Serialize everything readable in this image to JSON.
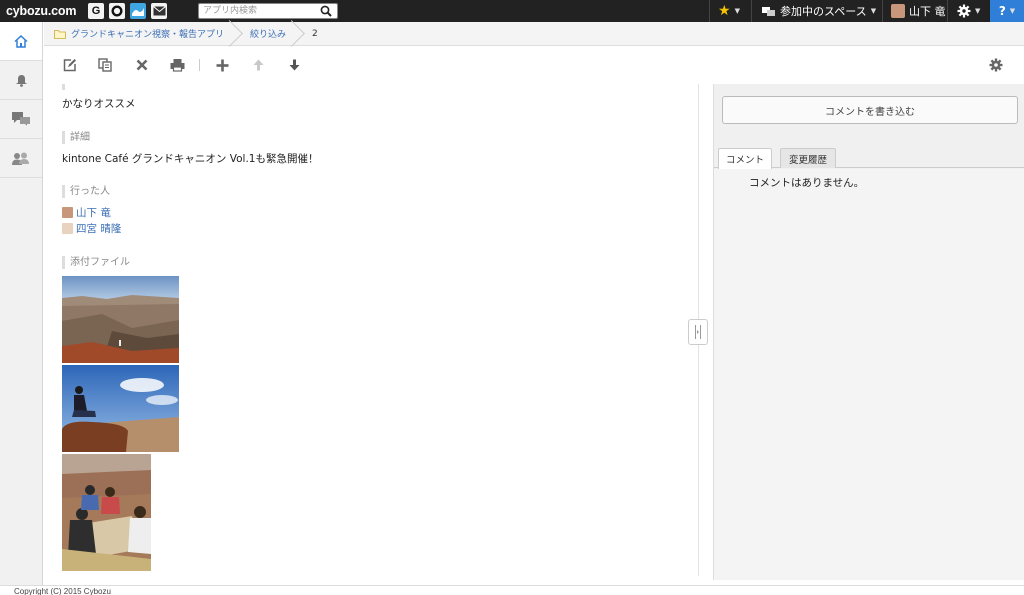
{
  "topbar": {
    "logo": "cybozu.com",
    "apps": [
      {
        "name": "garoon",
        "glyph": "G"
      },
      {
        "name": "office",
        "glyph": "O"
      },
      {
        "name": "kintone",
        "glyph": ""
      },
      {
        "name": "mail",
        "glyph": ""
      }
    ],
    "search_placeholder": "アプリ内検索",
    "spaces_label": "参加中のスペース",
    "user_name": "山下 竜",
    "help_label": "?"
  },
  "breadcrumb": {
    "app": "グランドキャニオン視察・報告アプリ",
    "filter": "絞り込み",
    "record_number": "2"
  },
  "record": {
    "recommend_value": "かなりオススメ",
    "detail_label": "詳細",
    "detail_value": "kintone Café グランドキャニオン Vol.1も緊急開催！",
    "visitors_label": "行った人",
    "visitors": [
      "山下 竜",
      "四宮 晴隆"
    ],
    "attachments_label": "添付ファイル"
  },
  "comments": {
    "write_button": "コメントを書き込む",
    "tabs": [
      "コメント",
      "変更履歴"
    ],
    "empty_message": "コメントはありません。"
  },
  "footer": {
    "copyright": "Copyright (C) 2015 Cybozu"
  },
  "colors": {
    "topbar": "#222222",
    "help_button": "#2f7fd8",
    "link": "#3b6fb5",
    "active_nav_icon": "#2f7fd8"
  }
}
